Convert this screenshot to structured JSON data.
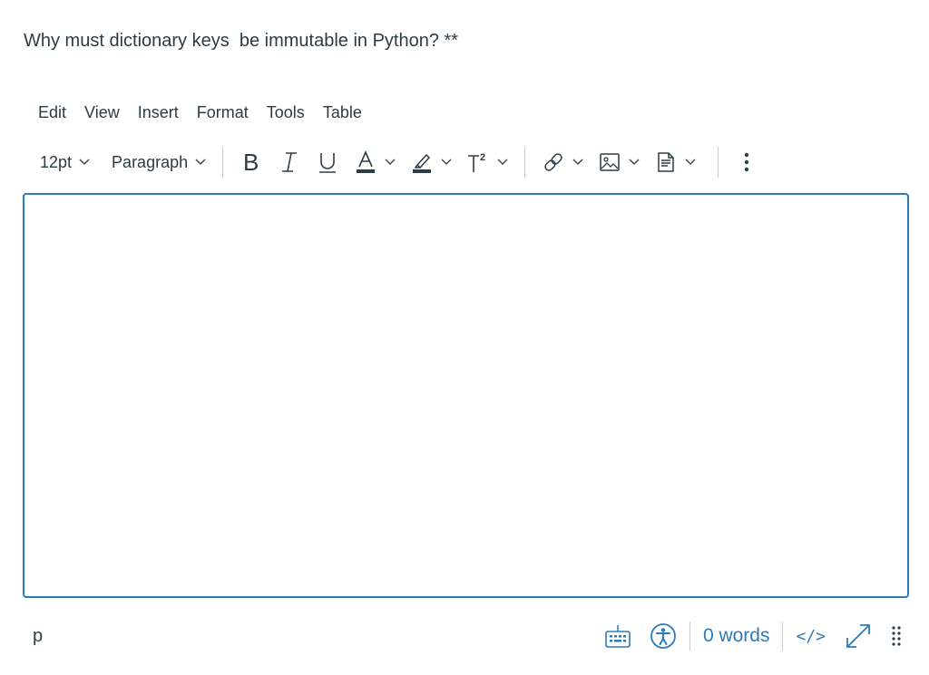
{
  "question": {
    "text": "Why must dictionary keys  be immutable in Python? **"
  },
  "menubar": {
    "items": [
      "Edit",
      "View",
      "Insert",
      "Format",
      "Tools",
      "Table"
    ]
  },
  "toolbar": {
    "font_size": "12pt",
    "block_format": "Paragraph",
    "icons": [
      "bold-icon",
      "italic-icon",
      "underline-icon",
      "text-color-icon",
      "highlight-icon",
      "superscript-icon",
      "link-icon",
      "image-icon",
      "document-icon",
      "more-icon"
    ]
  },
  "editor": {
    "content": ""
  },
  "statusbar": {
    "path": "p",
    "word_count": "0 words",
    "code_view": "</>"
  },
  "colors": {
    "accent": "#2b7abc",
    "text": "#2d3b45",
    "divider": "#c7cdd1"
  }
}
